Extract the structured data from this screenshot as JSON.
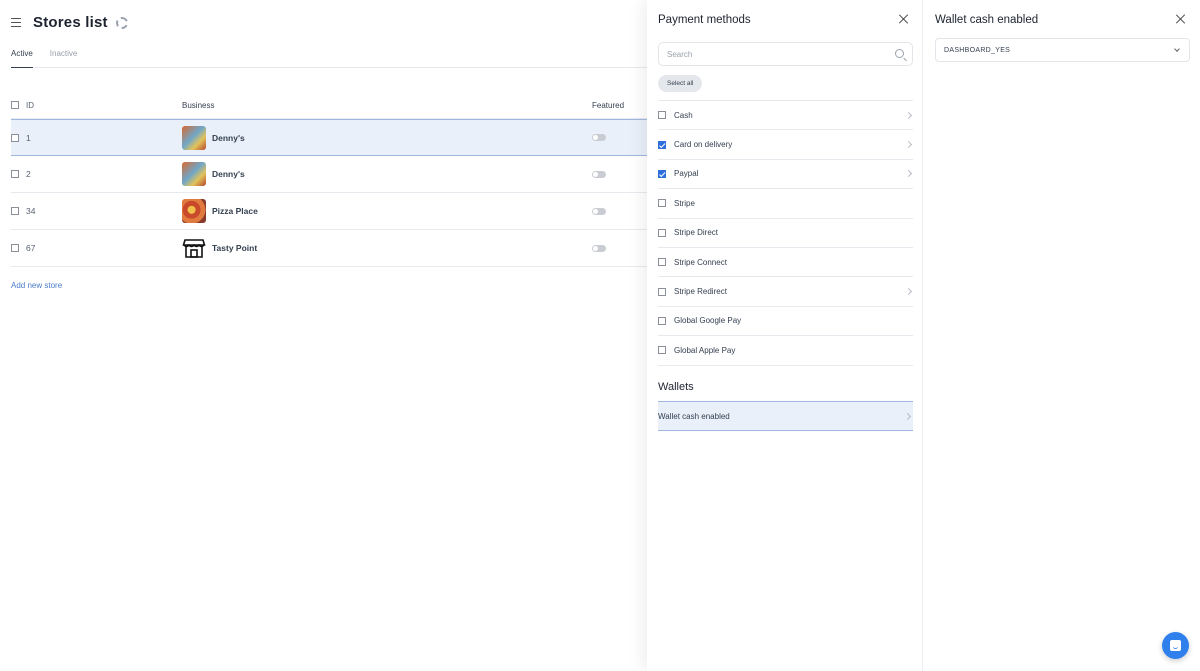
{
  "header": {
    "title": "Stores list"
  },
  "tabs": [
    {
      "label": "Active"
    },
    {
      "label": "Inactive"
    }
  ],
  "table": {
    "columns": {
      "id": "ID",
      "business": "Business",
      "featured": "Featured"
    },
    "rows": [
      {
        "id": "1",
        "business": "Denny's",
        "featured": false
      },
      {
        "id": "2",
        "business": "Denny's",
        "featured": false
      },
      {
        "id": "34",
        "business": "Pizza Place",
        "featured": false
      },
      {
        "id": "67",
        "business": "Tasty Point",
        "featured": false
      }
    ],
    "add_link": "Add new store"
  },
  "payment_panel": {
    "title": "Payment methods",
    "search_placeholder": "Search",
    "select_all": "Select all",
    "methods": [
      {
        "label": "Cash",
        "checked": false
      },
      {
        "label": "Card on delivery",
        "checked": true
      },
      {
        "label": "Paypal",
        "checked": true
      },
      {
        "label": "Stripe",
        "checked": false
      },
      {
        "label": "Stripe Direct",
        "checked": false
      },
      {
        "label": "Stripe Connect",
        "checked": false
      },
      {
        "label": "Stripe Redirect",
        "checked": false
      },
      {
        "label": "Global Google Pay",
        "checked": false
      },
      {
        "label": "Global Apple Pay",
        "checked": false
      }
    ],
    "wallets_title": "Wallets",
    "wallet_item": "Wallet cash enabled"
  },
  "wallet_panel": {
    "title": "Wallet cash enabled",
    "selected_value": "DASHBOARD_YES"
  },
  "colors": {
    "accent": "#2f6fdb",
    "selected_row": "#e9f0fa",
    "link": "#4a7cc9"
  }
}
